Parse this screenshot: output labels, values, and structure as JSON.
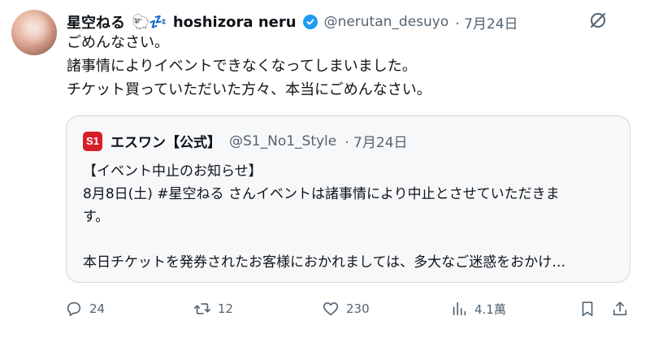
{
  "author": {
    "display_name": "星空ねる",
    "status_emoji": "🐑💤",
    "name_en": "hoshizora neru",
    "handle": "@nerutan_desuyo",
    "date": "· 7月24日"
  },
  "post": {
    "lines": [
      "ごめんなさい。",
      "諸事情によりイベントできなくなってしまいました。",
      "チケット買っていただいた方々、本当にごめんなさい。"
    ]
  },
  "quote": {
    "logo_text": "S1",
    "name": "エスワン【公式】",
    "handle": "@S1_No1_Style",
    "date": "· 7月24日",
    "lines": [
      "【イベント中止のお知らせ】",
      "8月8日(土) #星空ねる さんイベントは諸事情により中止とさせていただきま",
      "す。",
      "",
      "本日チケットを発券されたお客様におかれましては、多大なご迷惑をおかけ…"
    ]
  },
  "actions": {
    "replies": "24",
    "reposts": "12",
    "likes": "230",
    "views": "4.1萬"
  },
  "icons": {
    "more": "grok-icon",
    "reply": "reply-icon",
    "repost": "repost-icon",
    "like": "heart-icon",
    "views": "views-icon",
    "bookmark": "bookmark-icon",
    "share": "share-icon"
  },
  "colors": {
    "verified": "#1d9bf0",
    "muted": "#536471",
    "text": "#0f1419",
    "border": "#cfd9de",
    "logo": "#d71f2a"
  }
}
